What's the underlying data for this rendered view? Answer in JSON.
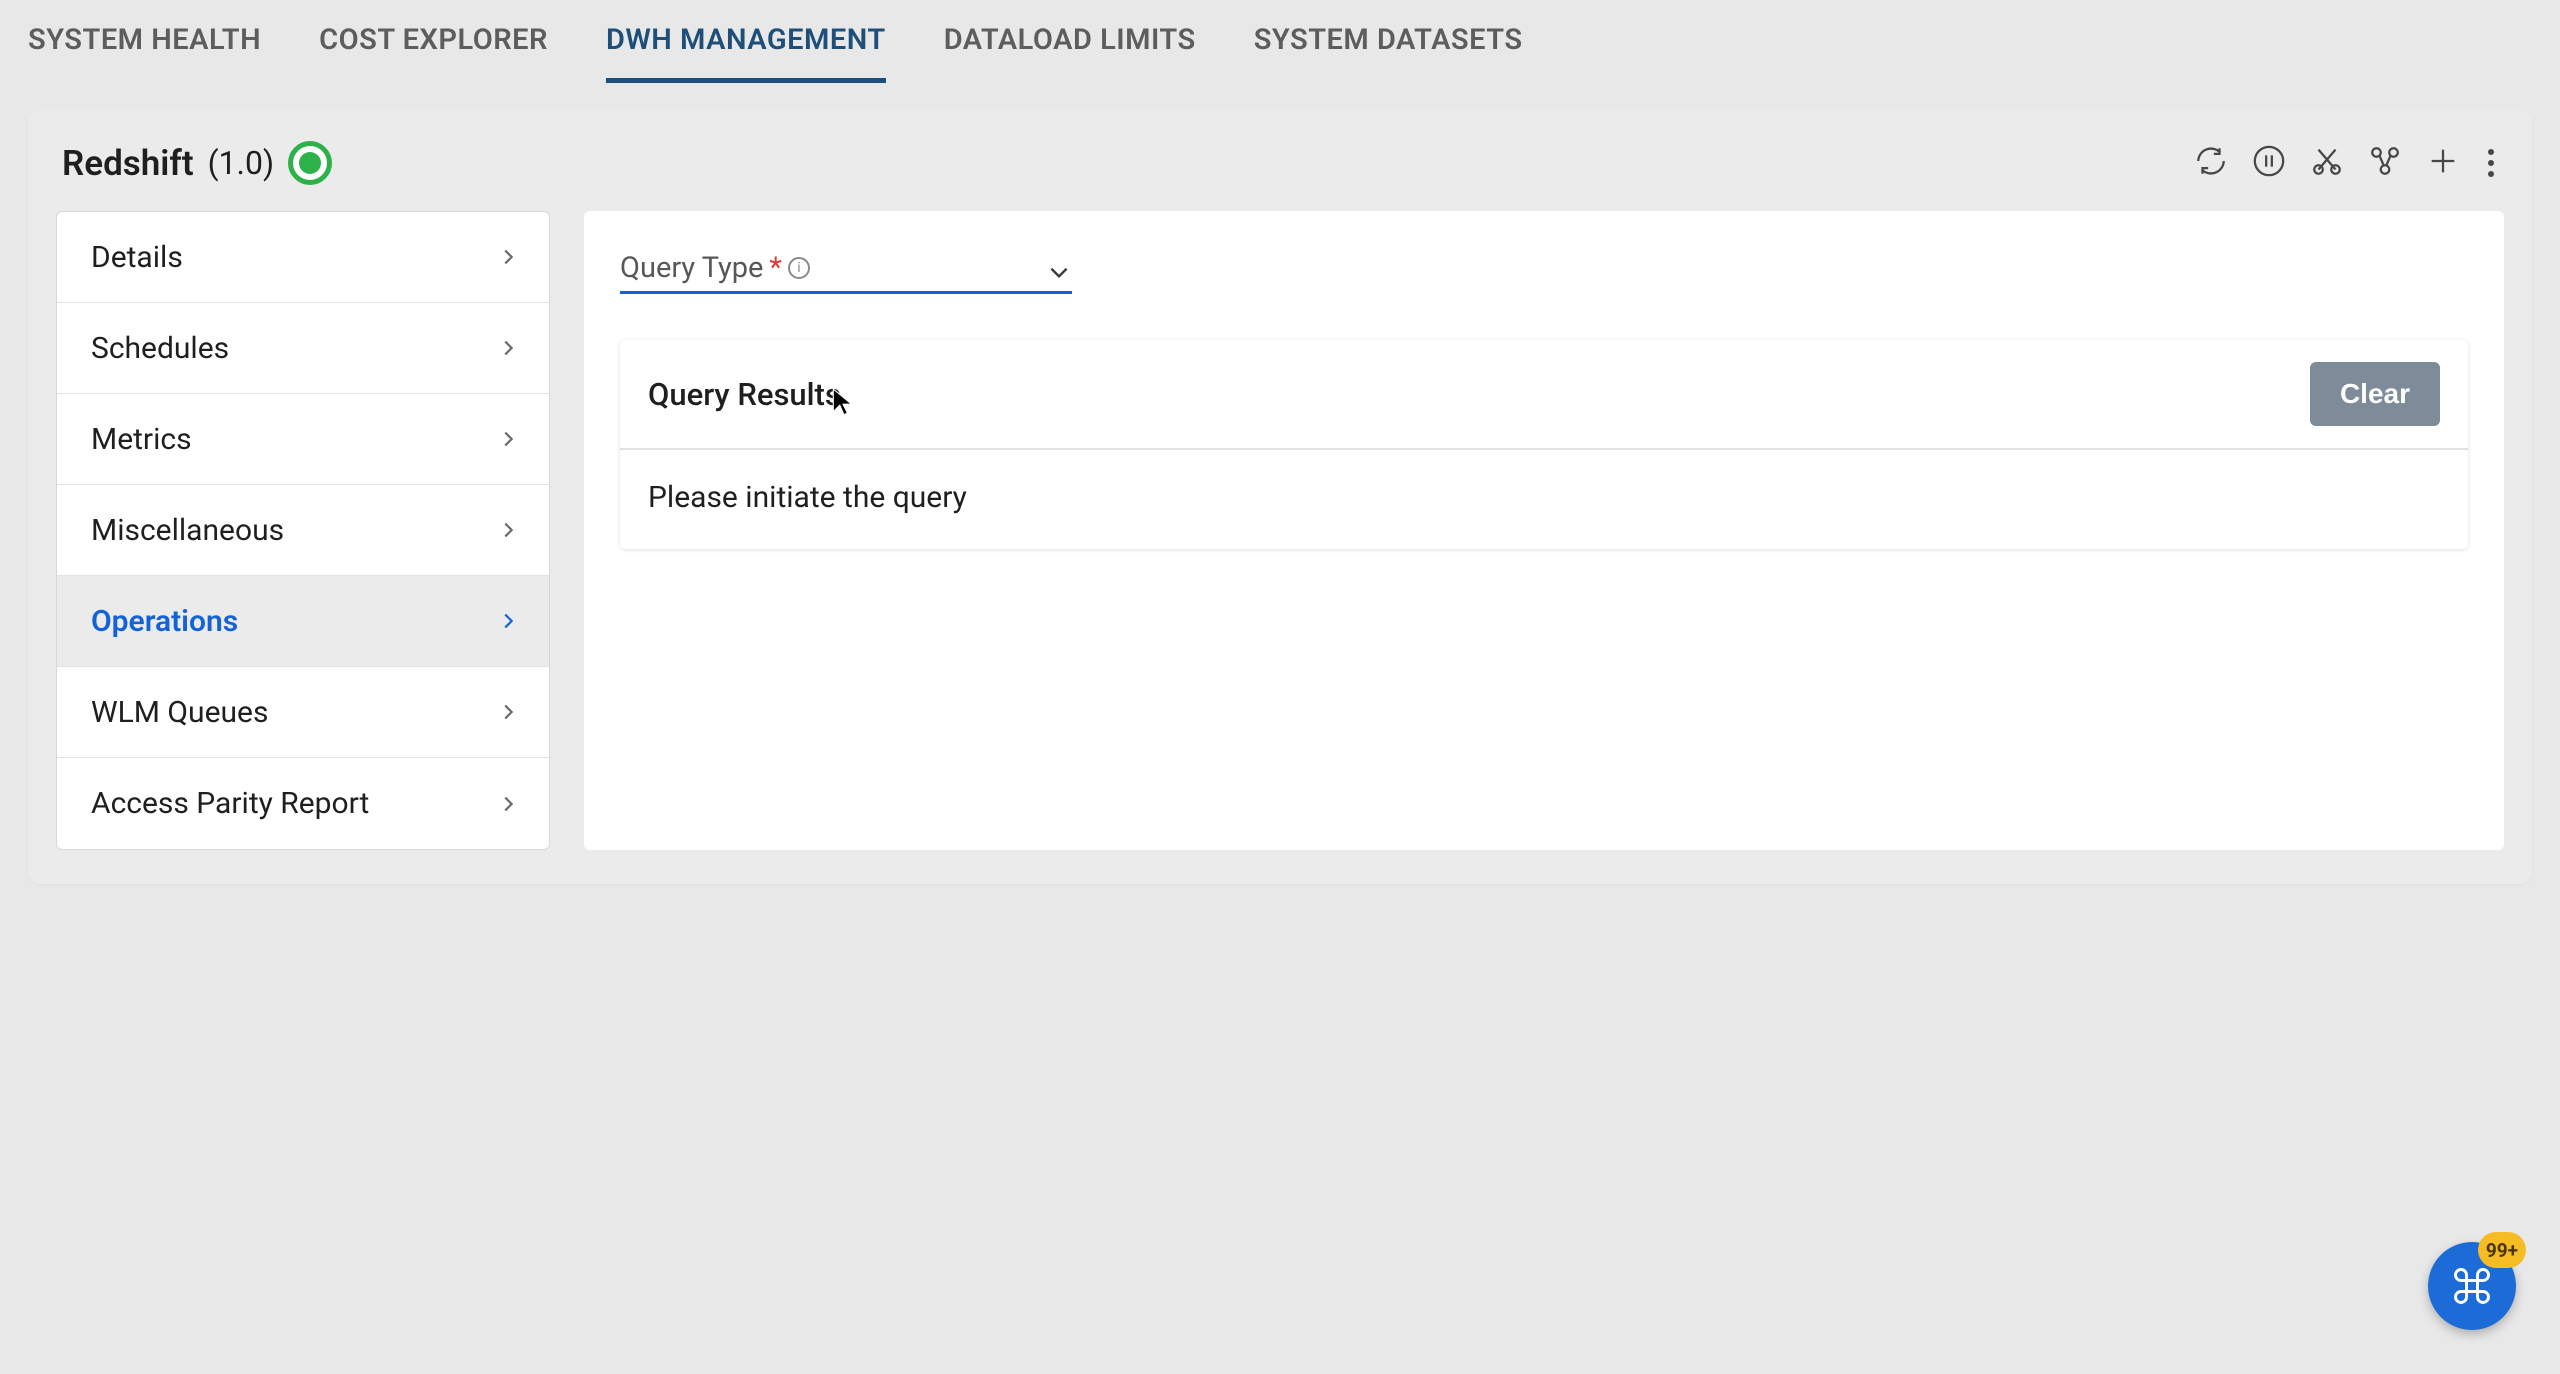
{
  "tabs": [
    {
      "label": "SYSTEM HEALTH"
    },
    {
      "label": "COST EXPLORER"
    },
    {
      "label": "DWH MANAGEMENT"
    },
    {
      "label": "DATALOAD LIMITS"
    },
    {
      "label": "SYSTEM DATASETS"
    }
  ],
  "activeTabIndex": 2,
  "header": {
    "title": "Redshift",
    "version": "(1.0)"
  },
  "sidebar": {
    "items": [
      {
        "label": "Details"
      },
      {
        "label": "Schedules"
      },
      {
        "label": "Metrics"
      },
      {
        "label": "Miscellaneous"
      },
      {
        "label": "Operations"
      },
      {
        "label": "WLM Queues"
      },
      {
        "label": "Access Parity Report"
      }
    ],
    "activeIndex": 4
  },
  "queryType": {
    "label": "Query Type",
    "required_marker": "*"
  },
  "results": {
    "title": "Query Results",
    "clear_label": "Clear",
    "body": "Please initiate the query"
  },
  "fab": {
    "badge": "99+"
  },
  "info_glyph": "i"
}
